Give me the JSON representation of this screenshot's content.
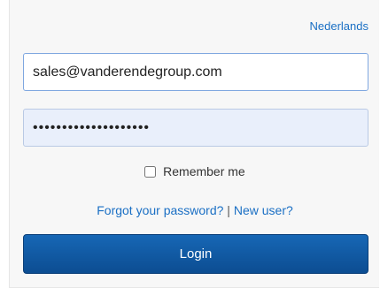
{
  "language_link": "Nederlands",
  "email": {
    "value": "sales@vanderendegroup.com"
  },
  "password": {
    "value": "••••••••••••••••••••"
  },
  "remember": {
    "label": "Remember me",
    "checked": false
  },
  "links": {
    "forgot": "Forgot your password?",
    "separator": " | ",
    "new_user": "New user?"
  },
  "login_button": "Login",
  "colors": {
    "link": "#1a6fc4",
    "button_top": "#1767b5",
    "button_bottom": "#0c4d92",
    "password_bg": "#e9effb"
  }
}
